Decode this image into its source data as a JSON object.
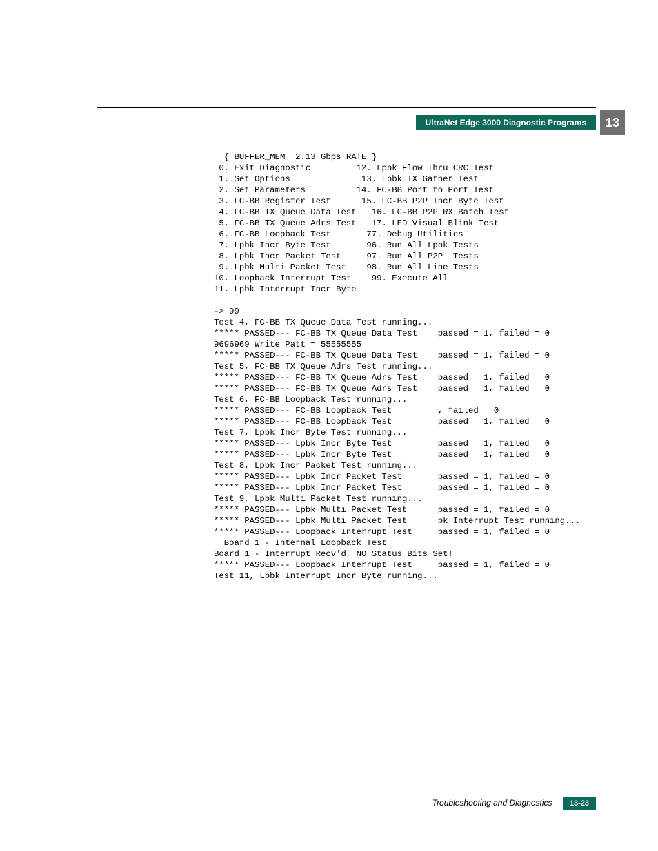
{
  "header": {
    "title": "UltraNet Edge 3000 Diagnostic Programs",
    "chapter": "13"
  },
  "code": "  { BUFFER_MEM  2.13 Gbps RATE }\n 0. Exit Diagnostic         12. Lpbk Flow Thru CRC Test\n 1. Set Options              13. Lpbk TX Gather Test\n 2. Set Parameters          14. FC-BB Port to Port Test\n 3. FC-BB Register Test      15. FC-BB P2P Incr Byte Test\n 4. FC-BB TX Queue Data Test   16. FC-BB P2P RX Batch Test\n 5. FC-BB TX Queue Adrs Test   17. LED Visual Blink Test\n 6. FC-BB Loopback Test       77. Debug Utilities\n 7. Lpbk Incr Byte Test       96. Run All Lpbk Tests\n 8. Lpbk Incr Packet Test     97. Run All P2P  Tests\n 9. Lpbk Multi Packet Test    98. Run All Line Tests\n10. Loopback Interrupt Test    99. Execute All\n11. Lpbk Interrupt Incr Byte\n\n-> 99\nTest 4, FC-BB TX Queue Data Test running...\n***** PASSED--- FC-BB TX Queue Data Test    passed = 1, failed = 0   9696969 Write Patt = 55555555\n***** PASSED--- FC-BB TX Queue Data Test    passed = 1, failed = 0\nTest 5, FC-BB TX Queue Adrs Test running...\n***** PASSED--- FC-BB TX Queue Adrs Test    passed = 1, failed = 0\n***** PASSED--- FC-BB TX Queue Adrs Test    passed = 1, failed = 0\nTest 6, FC-BB Loopback Test running...\n***** PASSED--- FC-BB Loopback Test         , failed = 0\n***** PASSED--- FC-BB Loopback Test         passed = 1, failed = 0\nTest 7, Lpbk Incr Byte Test running...\n***** PASSED--- Lpbk Incr Byte Test         passed = 1, failed = 0\n***** PASSED--- Lpbk Incr Byte Test         passed = 1, failed = 0\nTest 8, Lpbk Incr Packet Test running...\n***** PASSED--- Lpbk Incr Packet Test       passed = 1, failed = 0\n***** PASSED--- Lpbk Incr Packet Test       passed = 1, failed = 0\nTest 9, Lpbk Multi Packet Test running...\n***** PASSED--- Lpbk Multi Packet Test      passed = 1, failed = 0\n***** PASSED--- Lpbk Multi Packet Test      pk Interrupt Test running...\n***** PASSED--- Loopback Interrupt Test     passed = 1, failed = 0\n  Board 1 - Internal Loopback Test\nBoard 1 - Interrupt Recv'd, NO Status Bits Set!\n***** PASSED--- Loopback Interrupt Test     passed = 1, failed = 0\nTest 11, Lpbk Interrupt Incr Byte running...",
  "footer": {
    "title": "Troubleshooting and Diagnostics",
    "page": "13-23"
  }
}
